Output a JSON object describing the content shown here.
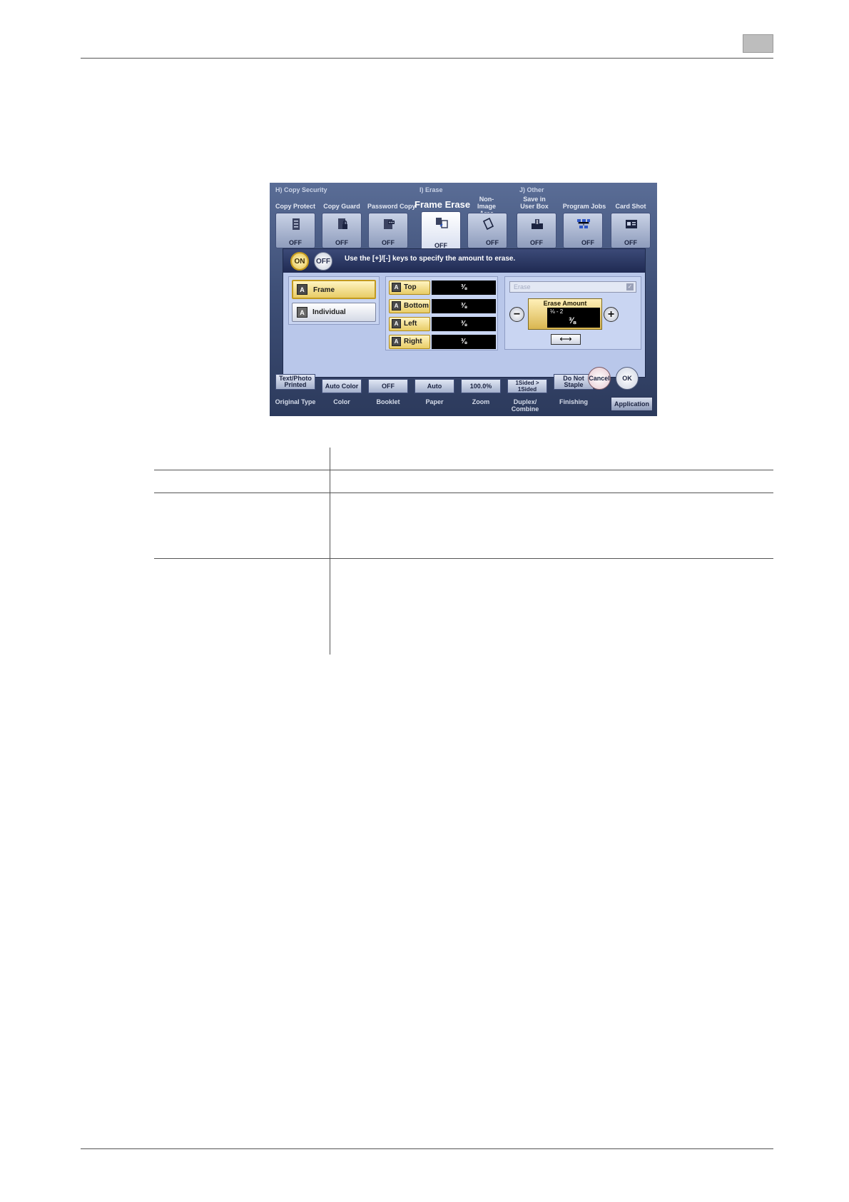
{
  "top_groups": {
    "copy_security": "H)  Copy Security",
    "erase": "I)  Erase",
    "other": "J)  Other"
  },
  "top_tiles": [
    {
      "label": "Copy Protect",
      "value": "OFF",
      "icon": "document-icon"
    },
    {
      "label": "Copy Guard",
      "value": "OFF",
      "icon": "lock-icon"
    },
    {
      "label": "Password Copy",
      "value": "OFF",
      "icon": "password-copy-icon"
    },
    {
      "label": "Frame Erase",
      "value": "OFF",
      "icon": "frame-erase-icon"
    },
    {
      "label": "Non-Image Area Erase",
      "value": "OFF",
      "icon": "non-image-erase-icon"
    },
    {
      "label": "Save in User Box",
      "value": "OFF",
      "icon": "save-box-icon"
    },
    {
      "label": "Program Jobs",
      "value": "OFF",
      "icon": "program-jobs-icon"
    },
    {
      "label": "Card Shot",
      "value": "OFF",
      "icon": "card-shot-icon"
    }
  ],
  "dialog": {
    "on_label": "ON",
    "off_label": "OFF",
    "instruction": "Use the [+]/[-] keys to specify the amount to erase.",
    "modes": [
      {
        "label": "Frame",
        "active": true
      },
      {
        "label": "Individual",
        "active": false
      }
    ],
    "sides": [
      {
        "label": "Top",
        "value": "⅜"
      },
      {
        "label": "Bottom",
        "value": "⅜"
      },
      {
        "label": "Left",
        "value": "⅜"
      },
      {
        "label": "Right",
        "value": "⅜"
      }
    ],
    "erase_select": "Erase",
    "amount_title": "Erase Amount",
    "amount_range": "⅛ - 2",
    "amount_value": "⅜",
    "minus": "−",
    "plus": "+",
    "arrow": "⟷"
  },
  "bottom_tiles": [
    {
      "value": "Text/Photo Printed",
      "label": "Original Type"
    },
    {
      "value": "Auto Color",
      "label": "Color"
    },
    {
      "value": "OFF",
      "label": "Booklet"
    },
    {
      "value": "Auto",
      "label": "Paper"
    },
    {
      "value": "100.0%",
      "label": "Zoom"
    },
    {
      "value": "1Sided > 1Sided",
      "label": "Duplex/ Combine"
    },
    {
      "value": "Do Not Staple",
      "label": "Finishing"
    }
  ],
  "cancel_label": "Cancel",
  "ok_label": "OK",
  "application_label": "Application"
}
